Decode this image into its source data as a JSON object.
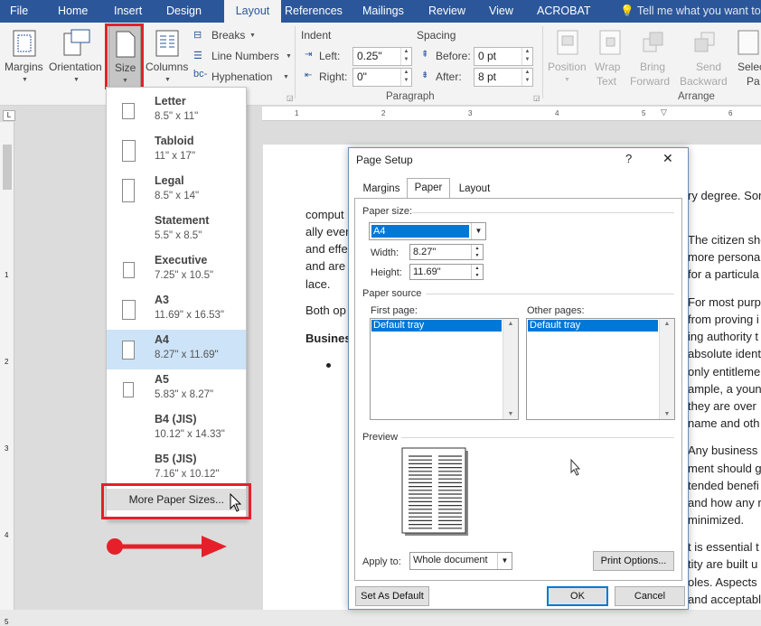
{
  "menubar": {
    "tabs": [
      "File",
      "Home",
      "Insert",
      "Design",
      "Layout",
      "References",
      "Mailings",
      "Review",
      "View",
      "ACROBAT"
    ],
    "active": "Layout",
    "tell_me": "Tell me what you want to"
  },
  "ribbon": {
    "margins": "Margins",
    "orientation": "Orientation",
    "size": "Size",
    "columns": "Columns",
    "breaks": "Breaks",
    "line_numbers": "Line Numbers",
    "hyphenation": "Hyphenation",
    "indent_title": "Indent",
    "left_label": "Left:",
    "left_value": "0.25\"",
    "right_label": "Right:",
    "right_value": "0\"",
    "spacing_title": "Spacing",
    "before_label": "Before:",
    "before_value": "0 pt",
    "after_label": "After:",
    "after_value": "8 pt",
    "paragraph_group": "Paragraph",
    "arrange_group": "Arrange",
    "position": "Position",
    "wrap_text_1": "Wrap",
    "wrap_text_2": "Text",
    "bring_forward_1": "Bring",
    "bring_forward_2": "Forward",
    "send_backward_1": "Send",
    "send_backward_2": "Backward",
    "select_1": "Selec",
    "select_2": "Pa"
  },
  "ruler": {
    "h_marks": [
      "1",
      "2",
      "3",
      "4",
      "5",
      "6"
    ],
    "v_marks": [
      "1",
      "2",
      "3",
      "4",
      "5"
    ]
  },
  "size_menu": {
    "items": [
      {
        "name": "Letter",
        "dims": "8.5\" x 11\""
      },
      {
        "name": "Tabloid",
        "dims": "11\" x 17\""
      },
      {
        "name": "Legal",
        "dims": "8.5\" x 14\""
      },
      {
        "name": "Statement",
        "dims": "5.5\" x 8.5\""
      },
      {
        "name": "Executive",
        "dims": "7.25\" x 10.5\""
      },
      {
        "name": "A3",
        "dims": "11.69\" x 16.53\""
      },
      {
        "name": "A4",
        "dims": "8.27\" x 11.69\""
      },
      {
        "name": "A5",
        "dims": "5.83\" x 8.27\""
      },
      {
        "name": "B4 (JIS)",
        "dims": "10.12\" x 14.33\""
      },
      {
        "name": "B5 (JIS)",
        "dims": "7.16\" x 10.12\""
      }
    ],
    "selected": "A4",
    "more": "More Paper Sizes..."
  },
  "document": {
    "left_lines": [
      "comput",
      "ally ever",
      "and effe",
      "and are",
      "lace.",
      "Both op",
      "Busines"
    ],
    "right_top": "ry degree.  Sor",
    "right_lines": [
      "The citizen sho",
      "more persona",
      "for a particula",
      "For most purp",
      "from proving i",
      "ing authority t",
      "absolute ident",
      "only entitleme",
      "ample, a youn",
      "they are over",
      "name and oth",
      "Any business c",
      "ment should g",
      "tended benefi",
      "and how any r",
      "minimized.",
      "t is essential t",
      "tity are built u",
      "oles.  Aspects",
      "and acceptabl"
    ]
  },
  "dialog": {
    "title": "Page Setup",
    "help": "?",
    "close": "✕",
    "tabs": [
      "Margins",
      "Paper",
      "Layout"
    ],
    "active_tab": "Paper",
    "paper_size_label": "Paper size:",
    "paper_size_value": "A4",
    "width_label": "Width:",
    "width_value": "8.27\"",
    "height_label": "Height:",
    "height_value": "11.69\"",
    "paper_source_label": "Paper source",
    "first_page_label": "First page:",
    "first_page_value": "Default tray",
    "other_pages_label": "Other pages:",
    "other_pages_value": "Default tray",
    "preview_label": "Preview",
    "apply_to_label": "Apply to:",
    "apply_to_value": "Whole document",
    "print_options": "Print Options...",
    "set_default": "Set As Default",
    "ok": "OK",
    "cancel": "Cancel"
  },
  "colors": {
    "accent": "#2b579a",
    "highlight": "#e5202a",
    "selection": "#0078d7"
  }
}
